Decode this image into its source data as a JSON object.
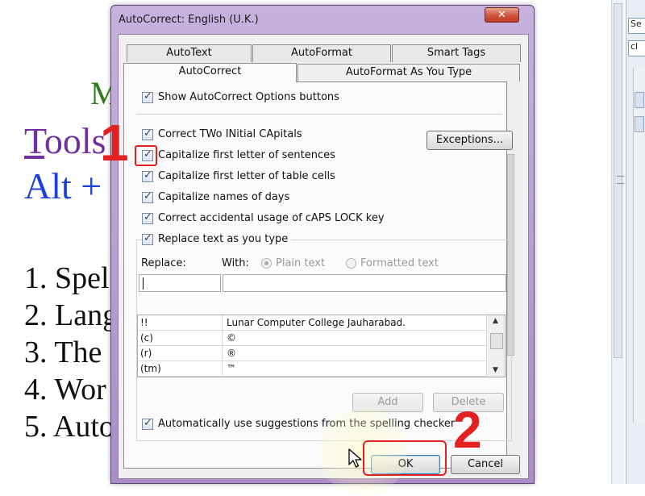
{
  "background_doc": {
    "heading_m": "M",
    "heading_tools_first": "T",
    "heading_tools_rest": "ools",
    "heading_alt": "Alt +",
    "list": [
      "1. Spel",
      "2. Lang",
      "3. The",
      "4. Wor",
      "5. Auto"
    ]
  },
  "right_panel": {
    "field1": "Se",
    "field2": "cl"
  },
  "dialog": {
    "title": "AutoCorrect: English (U.K.)",
    "close_glyph": "✕",
    "tabs_back": [
      "AutoText",
      "AutoFormat",
      "Smart Tags"
    ],
    "tabs_front": [
      "AutoCorrect",
      "AutoFormat As You Type"
    ],
    "show_options_label": "Show AutoCorrect Options buttons",
    "options": [
      {
        "label": "Correct TWo INitial CApitals",
        "checked": true
      },
      {
        "label": "Capitalize first letter of sentences",
        "checked": true
      },
      {
        "label": "Capitalize first letter of table cells",
        "checked": true
      },
      {
        "label": "Capitalize names of days",
        "checked": true
      },
      {
        "label": "Correct accidental usage of cAPS LOCK key",
        "checked": true
      }
    ],
    "exceptions_label": "Exceptions...",
    "replace_text_label": "Replace text as you type",
    "replace_label": "Replace:",
    "with_label": "With:",
    "plain_text_label": "Plain text",
    "formatted_text_label": "Formatted text",
    "replace_value": "",
    "with_value": "",
    "entries": [
      {
        "replace": "!!",
        "with": "Lunar Computer College Jauharabad."
      },
      {
        "replace": "(c)",
        "with": "©"
      },
      {
        "replace": "(r)",
        "with": "®"
      },
      {
        "replace": "(tm)",
        "with": "™"
      }
    ],
    "add_label": "Add",
    "delete_label": "Delete",
    "spelling_label": "Automatically use suggestions from the spelling checker",
    "ok_label": "OK",
    "cancel_label": "Cancel"
  },
  "annotations": {
    "step1": "1",
    "step2": "2",
    "color": "#e32121"
  }
}
